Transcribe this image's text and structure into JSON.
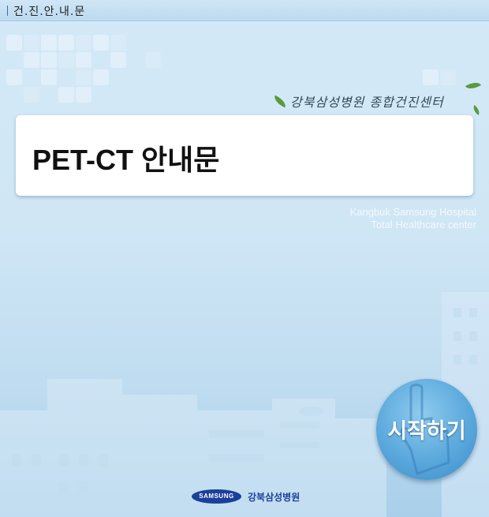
{
  "topbar": {
    "title": "건.진.안.내.문"
  },
  "branding": {
    "hospital_korean": "강북삼성병원 종합건진센터",
    "english_line1": "Kangbuk Samsung Hospital",
    "english_line2": "Total Healthcare center"
  },
  "card": {
    "heading": "PET-CT 안내문"
  },
  "start_button": {
    "label": "시작하기"
  },
  "footer": {
    "samsung_logo": "SAMSUNG",
    "hospital_name": "강북삼성병원"
  },
  "colors": {
    "accent_blue": "#4a9ad4",
    "brand_navy": "#1b3f9c",
    "leaf_green": "#5a9a3c"
  },
  "icons": [
    "pointing-hand-icon",
    "leaf-icon",
    "samsung-logo"
  ]
}
